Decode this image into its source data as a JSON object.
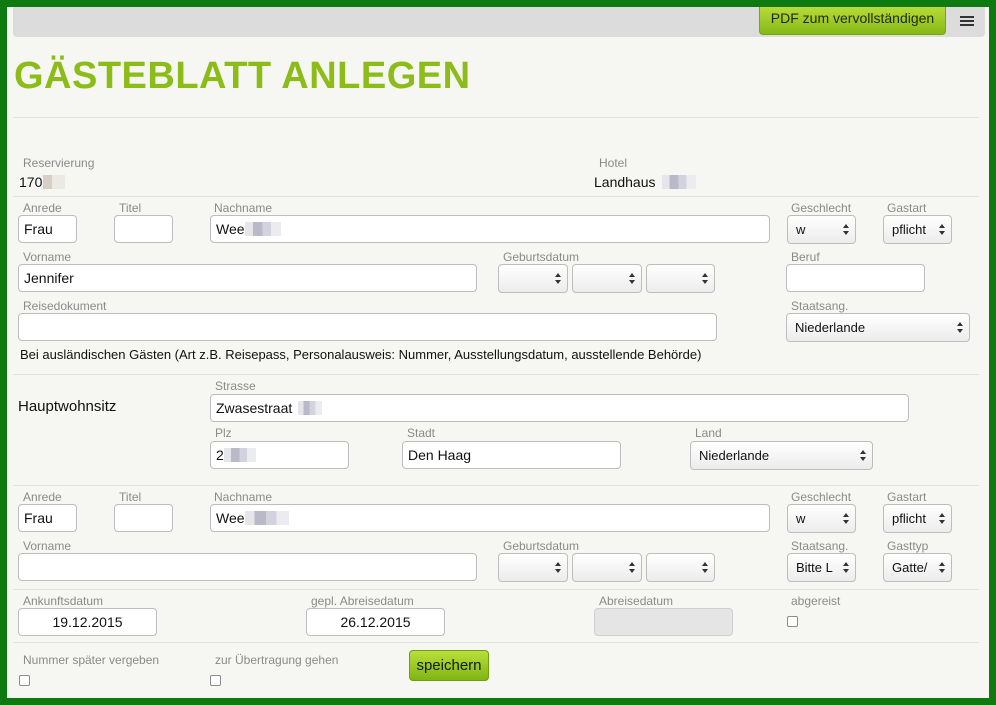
{
  "toolbar": {
    "pdf_label": "PDF zum vervollständigen",
    "menu_icon": "list-icon"
  },
  "page_title": "GÄSTEBLATT ANLEGEN",
  "colors": {
    "accent": "#8cbc18",
    "frame": "#0f7a10",
    "button": "#a4cf26"
  },
  "reservation": {
    "label": "Reservierung",
    "value": "170"
  },
  "hotel": {
    "label": "Hotel",
    "value": "Landhaus"
  },
  "guest1": {
    "anrede_label": "Anrede",
    "anrede": "Frau",
    "titel_label": "Titel",
    "titel": "",
    "nachname_label": "Nachname",
    "nachname": "Wee",
    "geschlecht_label": "Geschlecht",
    "geschlecht": "w",
    "gastart_label": "Gastart",
    "gastart": "pflicht",
    "vorname_label": "Vorname",
    "vorname": "Jennifer",
    "geburtsdatum_label": "Geburtsdatum",
    "beruf_label": "Beruf",
    "beruf": "",
    "reisedokument_label": "Reisedokument",
    "reisedokument": "",
    "staatsang_label": "Staatsang.",
    "staatsang": "Niederlande",
    "note": "Bei ausländischen Gästen (Art z.B. Reisepass, Personalausweis: Nummer, Ausstellungsdatum, ausstellende Behörde)"
  },
  "address": {
    "section_label": "Hauptwohnsitz",
    "strasse_label": "Strasse",
    "strasse": "Zwasestraat",
    "plz_label": "Plz",
    "plz": "2",
    "stadt_label": "Stadt",
    "stadt": "Den Haag",
    "land_label": "Land",
    "land": "Niederlande"
  },
  "guest2": {
    "anrede_label": "Anrede",
    "anrede": "Frau",
    "titel_label": "Titel",
    "titel": "",
    "nachname_label": "Nachname",
    "nachname": "Wee",
    "geschlecht_label": "Geschlecht",
    "geschlecht": "w",
    "gastart_label": "Gastart",
    "gastart": "pflicht",
    "vorname_label": "Vorname",
    "vorname": "",
    "geburtsdatum_label": "Geburtsdatum",
    "staatsang_label": "Staatsang.",
    "staatsang": "Bitte L",
    "gasttyp_label": "Gasttyp",
    "gasttyp": "Gatte/"
  },
  "stay": {
    "ankunft_label": "Ankunftsdatum",
    "ankunft": "19.12.2015",
    "gepl_abreise_label": "gepl. Abreisedatum",
    "gepl_abreise": "26.12.2015",
    "abreise_label": "Abreisedatum",
    "abreise": "",
    "abgereist_label": "abgereist"
  },
  "footer": {
    "nummer_label": "Nummer später vergeben",
    "uebertragung_label": "zur Übertragung gehen",
    "save_label": "speichern"
  }
}
